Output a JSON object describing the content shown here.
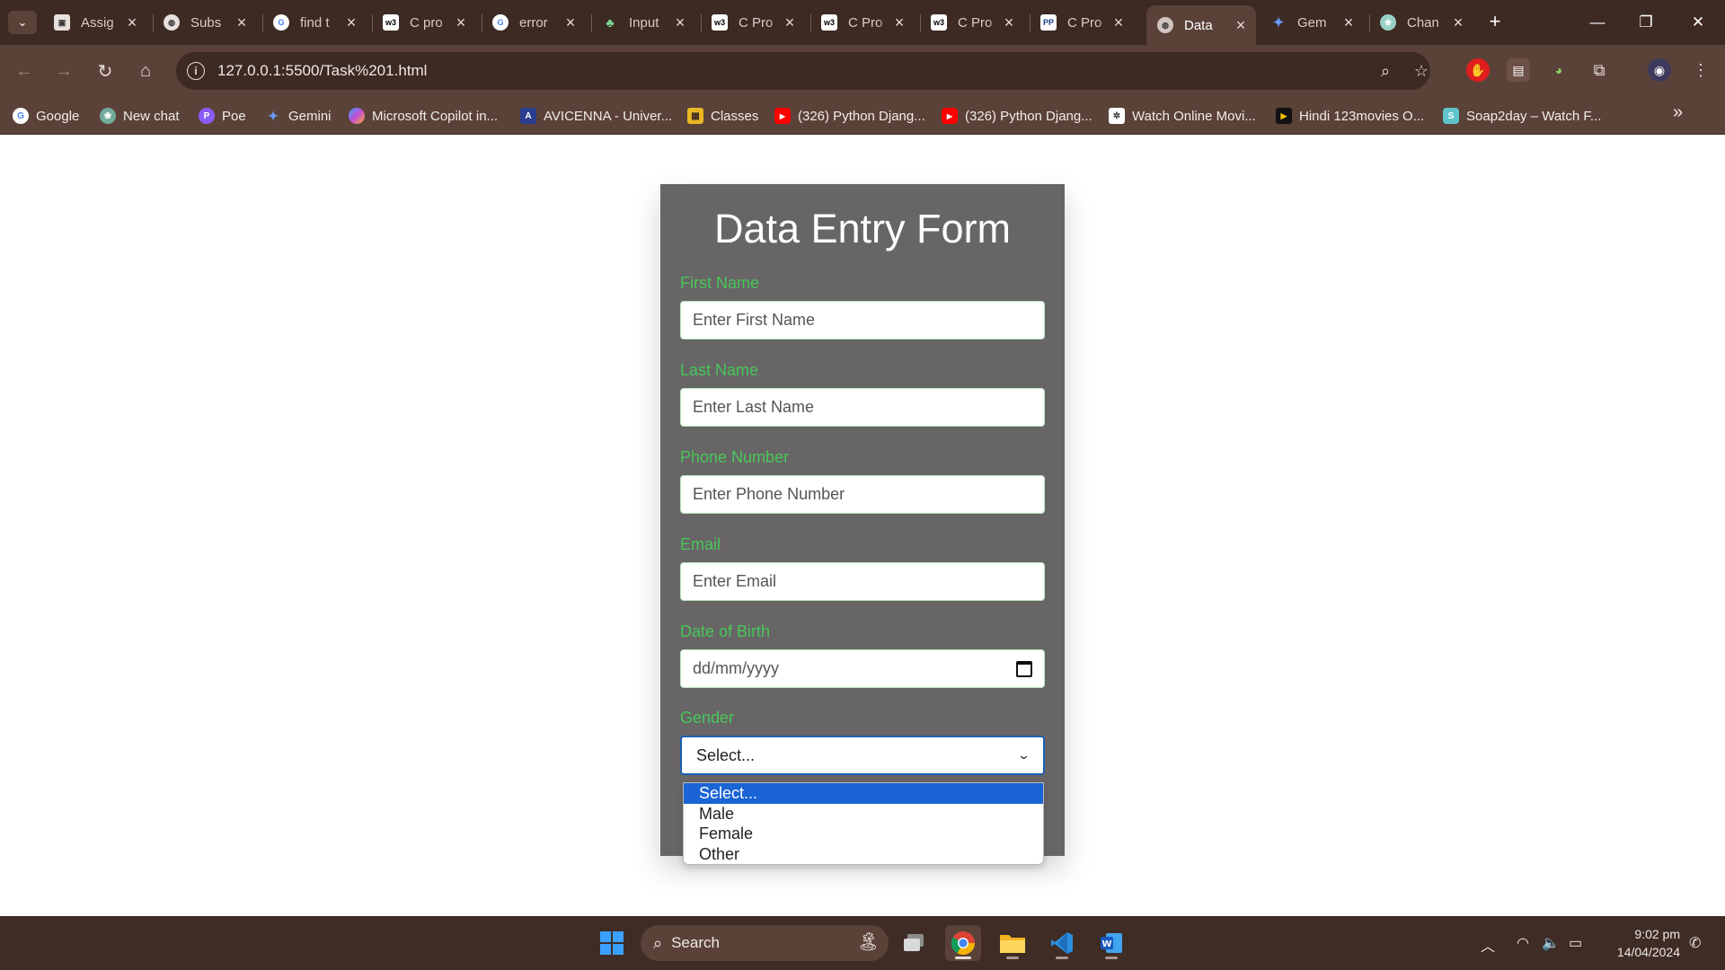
{
  "browser": {
    "tabs": [
      {
        "title": "Assig",
        "icon": "doc-icon",
        "active": false
      },
      {
        "title": "Subs",
        "icon": "globe-icon",
        "active": false
      },
      {
        "title": "find t",
        "icon": "google-icon",
        "active": false
      },
      {
        "title": "C pro",
        "icon": "w3schools-icon",
        "active": false
      },
      {
        "title": "error",
        "icon": "google-icon",
        "active": false
      },
      {
        "title": "Input",
        "icon": "app-icon",
        "active": false
      },
      {
        "title": "C Pro",
        "icon": "w3schools-icon",
        "active": false
      },
      {
        "title": "C Pro",
        "icon": "w3schools-icon",
        "active": false
      },
      {
        "title": "C Pro",
        "icon": "w3schools-icon",
        "active": false
      },
      {
        "title": "C Pro",
        "icon": "programiz-icon",
        "active": false
      },
      {
        "title": "Data",
        "icon": "globe-icon",
        "active": true
      },
      {
        "title": "Gem",
        "icon": "gemini-icon",
        "active": false
      },
      {
        "title": "Chan",
        "icon": "chatgpt-icon",
        "active": false
      }
    ],
    "url": "127.0.0.1:5500/Task%201.html",
    "bookmarks": [
      {
        "label": "Google",
        "icon": "google-icon",
        "color": "#ffffff"
      },
      {
        "label": "New chat",
        "icon": "chatgpt-icon",
        "color": "#74aa9c"
      },
      {
        "label": "Poe",
        "icon": "poe-icon",
        "color": "#8a5cf6"
      },
      {
        "label": "Gemini",
        "icon": "gemini-icon",
        "color": "#4a7df0"
      },
      {
        "label": "Microsoft Copilot in...",
        "icon": "copilot-icon",
        "color": "#c24fd3"
      },
      {
        "label": "AVICENNA - Univer...",
        "icon": "avicenna-icon",
        "color": "#2b3d8f"
      },
      {
        "label": "Classes",
        "icon": "classes-icon",
        "color": "#e9b824"
      },
      {
        "label": "(326) Python Djang...",
        "icon": "youtube-icon",
        "color": "#ff0000"
      },
      {
        "label": "(326) Python Djang...",
        "icon": "youtube-icon",
        "color": "#ff0000"
      },
      {
        "label": "Watch Online Movi...",
        "icon": "movie-icon",
        "color": "#ffffff"
      },
      {
        "label": "Hindi 123movies O...",
        "icon": "play-icon",
        "color": "#f2c200"
      },
      {
        "label": "Soap2day – Watch F...",
        "icon": "soap2day-icon",
        "color": "#5ec4c9"
      }
    ]
  },
  "form": {
    "title": "Data Entry Form",
    "fields": {
      "first_name": {
        "label": "First Name",
        "placeholder": "Enter First Name"
      },
      "last_name": {
        "label": "Last Name",
        "placeholder": "Enter Last Name"
      },
      "phone": {
        "label": "Phone Number",
        "placeholder": "Enter Phone Number"
      },
      "email": {
        "label": "Email",
        "placeholder": "Enter Email"
      },
      "dob": {
        "label": "Date of Birth",
        "placeholder": "dd/mm/yyyy"
      },
      "gender": {
        "label": "Gender",
        "value": "Select...",
        "options": [
          "Select...",
          "Male",
          "Female",
          "Other"
        ]
      }
    }
  },
  "taskbar": {
    "search_label": "Search",
    "time": "9:02 pm",
    "date": "14/04/2024"
  },
  "colors": {
    "label_green": "#47c75a",
    "card_bg": "#686566",
    "chrome_dark": "#3c2a23",
    "chrome_mid": "#5a4239",
    "select_highlight": "#1a64d6"
  }
}
